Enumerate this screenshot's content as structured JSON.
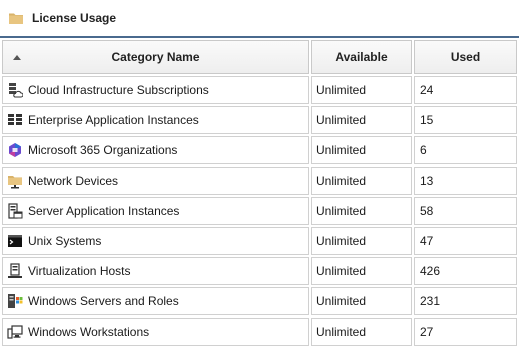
{
  "panel": {
    "title": "License Usage",
    "icon": "folder-icon"
  },
  "columns": {
    "category": "Category Name",
    "available": "Available",
    "used": "Used"
  },
  "rows": [
    {
      "name": "Cloud Infrastructure Subscriptions",
      "available": "Unlimited",
      "used": "24",
      "icon": "cloud-server-icon"
    },
    {
      "name": "Enterprise Application Instances",
      "available": "Unlimited",
      "used": "15",
      "icon": "server-stack-icon"
    },
    {
      "name": "Microsoft 365 Organizations",
      "available": "Unlimited",
      "used": "6",
      "icon": "microsoft-365-icon"
    },
    {
      "name": "Network Devices",
      "available": "Unlimited",
      "used": "13",
      "icon": "network-folder-icon"
    },
    {
      "name": "Server Application Instances",
      "available": "Unlimited",
      "used": "58",
      "icon": "server-app-icon"
    },
    {
      "name": "Unix Systems",
      "available": "Unlimited",
      "used": "47",
      "icon": "terminal-icon"
    },
    {
      "name": "Virtualization Hosts",
      "available": "Unlimited",
      "used": "426",
      "icon": "virtualization-host-icon"
    },
    {
      "name": "Windows Servers and Roles",
      "available": "Unlimited",
      "used": "231",
      "icon": "windows-server-icon"
    },
    {
      "name": "Windows Workstations",
      "available": "Unlimited",
      "used": "27",
      "icon": "workstation-icon"
    }
  ],
  "colors": {
    "header_border": "#4a6a8e",
    "folder": "#d9b36a",
    "m365_blue": "#2b6fd6",
    "m365_purple": "#8a3ec9"
  }
}
